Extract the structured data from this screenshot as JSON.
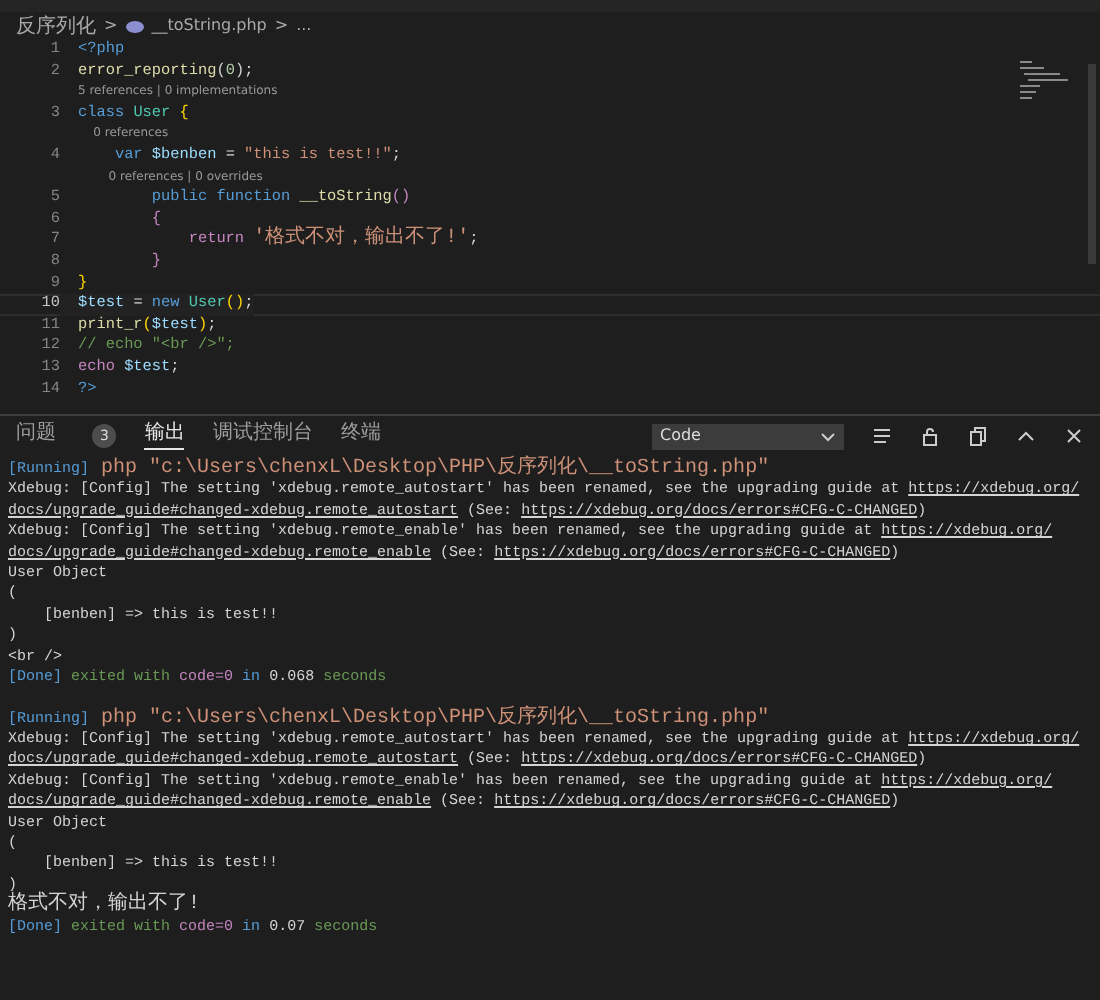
{
  "breadcrumb": {
    "items": [
      "反序列化",
      "__toString.php",
      "..."
    ],
    "separator": ">"
  },
  "editor": {
    "lines": [
      {
        "kind": "code",
        "number": "1",
        "current": false,
        "tokens": [
          {
            "text": "<?php",
            "kind": "kw"
          }
        ]
      },
      {
        "kind": "code",
        "number": "2",
        "current": false,
        "tokens": [
          {
            "text": "error_reporting",
            "kind": "fn"
          },
          {
            "text": "(",
            "kind": "plain"
          },
          {
            "text": "0",
            "kind": "num"
          },
          {
            "text": ");",
            "kind": "plain"
          }
        ]
      },
      {
        "kind": "lens",
        "text": "5 references | 0 implementations"
      },
      {
        "kind": "code",
        "number": "3",
        "current": false,
        "tokens": [
          {
            "text": "class ",
            "kind": "kw"
          },
          {
            "text": "User",
            "kind": "cls"
          },
          {
            "text": " {",
            "kind": "br"
          }
        ]
      },
      {
        "kind": "lens",
        "text": "    0 references"
      },
      {
        "kind": "code",
        "number": "4",
        "current": false,
        "tokens": [
          {
            "text": "    var",
            "kind": "kw"
          },
          {
            "text": " $benben",
            "kind": "var"
          },
          {
            "text": " = ",
            "kind": "plain"
          },
          {
            "text": "\"this is test!!\"",
            "kind": "str"
          },
          {
            "text": ";",
            "kind": "plain"
          }
        ]
      },
      {
        "kind": "lens",
        "text": "        0 references | 0 overrides"
      },
      {
        "kind": "code",
        "number": "5",
        "current": false,
        "tokens": [
          {
            "text": "        public function",
            "kind": "kw"
          },
          {
            "text": " __toString",
            "kind": "fn"
          },
          {
            "text": "()",
            "kind": "ctl"
          }
        ]
      },
      {
        "kind": "code",
        "number": "6",
        "current": false,
        "tokens": [
          {
            "text": "        {",
            "kind": "ctl"
          }
        ]
      },
      {
        "kind": "code",
        "number": "7",
        "current": false,
        "tokens": [
          {
            "text": "            return ",
            "kind": "ctl"
          },
          {
            "text": "'格式不对，输出不了!'",
            "kind": "str"
          },
          {
            "text": ";",
            "kind": "plain"
          }
        ]
      },
      {
        "kind": "code",
        "number": "8",
        "current": false,
        "tokens": [
          {
            "text": "        }",
            "kind": "ctl"
          }
        ]
      },
      {
        "kind": "code",
        "number": "9",
        "current": false,
        "tokens": [
          {
            "text": "}",
            "kind": "br"
          }
        ]
      },
      {
        "kind": "code",
        "number": "10",
        "current": true,
        "tokens": [
          {
            "text": "$test",
            "kind": "var"
          },
          {
            "text": " = ",
            "kind": "plain"
          },
          {
            "text": "new ",
            "kind": "kw"
          },
          {
            "text": "User",
            "kind": "cls"
          },
          {
            "text": "()",
            "kind": "br"
          },
          {
            "text": ";",
            "kind": "plain"
          }
        ]
      },
      {
        "kind": "code",
        "number": "11",
        "current": false,
        "tokens": [
          {
            "text": "print_r",
            "kind": "fn"
          },
          {
            "text": "(",
            "kind": "br"
          },
          {
            "text": "$test",
            "kind": "var"
          },
          {
            "text": ")",
            "kind": "br"
          },
          {
            "text": ";",
            "kind": "plain"
          }
        ]
      },
      {
        "kind": "code",
        "number": "12",
        "current": false,
        "tokens": [
          {
            "text": "// echo \"<br />\";",
            "kind": "cmt"
          }
        ]
      },
      {
        "kind": "code",
        "number": "13",
        "current": false,
        "tokens": [
          {
            "text": "echo",
            "kind": "ctl"
          },
          {
            "text": " $test",
            "kind": "var"
          },
          {
            "text": ";",
            "kind": "plain"
          }
        ]
      },
      {
        "kind": "code",
        "number": "14",
        "current": false,
        "tokens": [
          {
            "text": "?>",
            "kind": "kw"
          }
        ]
      }
    ]
  },
  "panel": {
    "tabs": [
      {
        "label": "问题",
        "badge": "3",
        "selected": false
      },
      {
        "label": "输出",
        "selected": true
      },
      {
        "label": "调试控制台",
        "selected": false
      },
      {
        "label": "终端",
        "selected": false
      }
    ],
    "channel": "Code",
    "output": [
      {
        "kind": "text",
        "tokens": [
          {
            "text": "[Running]",
            "kind": "tag"
          },
          {
            "text": " php \"c:\\Users\\chenxL\\Desktop\\PHP\\反序列化\\__toString.php\"",
            "kind": "str"
          }
        ]
      },
      {
        "kind": "text",
        "tokens": [
          {
            "text": "Xdebug: [Config] The setting 'xdebug.remote_autostart' has been renamed, see the upgrading guide at ",
            "kind": "plain"
          },
          {
            "text": "https://xdebug.org/",
            "kind": "link"
          }
        ]
      },
      {
        "kind": "text",
        "tokens": [
          {
            "text": "docs/upgrade_guide#changed-xdebug.remote_autostart",
            "kind": "link"
          },
          {
            "text": " (See: ",
            "kind": "plain"
          },
          {
            "text": "https://xdebug.org/docs/errors#CFG-C-CHANGED",
            "kind": "link"
          },
          {
            "text": ")",
            "kind": "plain"
          }
        ]
      },
      {
        "kind": "text",
        "tokens": [
          {
            "text": "Xdebug: [Config] The setting 'xdebug.remote_enable' has been renamed, see the upgrading guide at ",
            "kind": "plain"
          },
          {
            "text": "https://xdebug.org/",
            "kind": "link"
          }
        ]
      },
      {
        "kind": "text",
        "tokens": [
          {
            "text": "docs/upgrade_guide#changed-xdebug.remote_enable",
            "kind": "link"
          },
          {
            "text": " (See: ",
            "kind": "plain"
          },
          {
            "text": "https://xdebug.org/docs/errors#CFG-C-CHANGED",
            "kind": "link"
          },
          {
            "text": ")",
            "kind": "plain"
          }
        ]
      },
      {
        "kind": "text",
        "tokens": [
          {
            "text": "User Object",
            "kind": "plain"
          }
        ]
      },
      {
        "kind": "text",
        "tokens": [
          {
            "text": "(",
            "kind": "plain"
          }
        ]
      },
      {
        "kind": "text",
        "tokens": [
          {
            "text": "    [benben] => this is test!!",
            "kind": "plain"
          }
        ]
      },
      {
        "kind": "text",
        "tokens": [
          {
            "text": ")",
            "kind": "plain"
          }
        ]
      },
      {
        "kind": "text",
        "tokens": [
          {
            "text": "<br />",
            "kind": "plain"
          }
        ]
      },
      {
        "kind": "text",
        "tokens": [
          {
            "text": "[Done]",
            "kind": "tag"
          },
          {
            "text": " exited with ",
            "kind": "green"
          },
          {
            "text": "code=0",
            "kind": "purple"
          },
          {
            "text": " in ",
            "kind": "tag"
          },
          {
            "text": "0.068",
            "kind": "plain"
          },
          {
            "text": " seconds",
            "kind": "green"
          }
        ]
      },
      {
        "kind": "blank"
      },
      {
        "kind": "text",
        "tokens": [
          {
            "text": "[Running]",
            "kind": "tag"
          },
          {
            "text": " php \"c:\\Users\\chenxL\\Desktop\\PHP\\反序列化\\__toString.php\"",
            "kind": "str"
          }
        ]
      },
      {
        "kind": "text",
        "tokens": [
          {
            "text": "Xdebug: [Config] The setting 'xdebug.remote_autostart' has been renamed, see the upgrading guide at ",
            "kind": "plain"
          },
          {
            "text": "https://xdebug.org/",
            "kind": "link"
          }
        ]
      },
      {
        "kind": "text",
        "tokens": [
          {
            "text": "docs/upgrade_guide#changed-xdebug.remote_autostart",
            "kind": "link"
          },
          {
            "text": " (See: ",
            "kind": "plain"
          },
          {
            "text": "https://xdebug.org/docs/errors#CFG-C-CHANGED",
            "kind": "link"
          },
          {
            "text": ")",
            "kind": "plain"
          }
        ]
      },
      {
        "kind": "text",
        "tokens": [
          {
            "text": "Xdebug: [Config] The setting 'xdebug.remote_enable' has been renamed, see the upgrading guide at ",
            "kind": "plain"
          },
          {
            "text": "https://xdebug.org/",
            "kind": "link"
          }
        ]
      },
      {
        "kind": "text",
        "tokens": [
          {
            "text": "docs/upgrade_guide#changed-xdebug.remote_enable",
            "kind": "link"
          },
          {
            "text": " (See: ",
            "kind": "plain"
          },
          {
            "text": "https://xdebug.org/docs/errors#CFG-C-CHANGED",
            "kind": "link"
          },
          {
            "text": ")",
            "kind": "plain"
          }
        ]
      },
      {
        "kind": "text",
        "tokens": [
          {
            "text": "User Object",
            "kind": "plain"
          }
        ]
      },
      {
        "kind": "text",
        "tokens": [
          {
            "text": "(",
            "kind": "plain"
          }
        ]
      },
      {
        "kind": "text",
        "tokens": [
          {
            "text": "    [benben] => this is test!!",
            "kind": "plain"
          }
        ]
      },
      {
        "kind": "text",
        "tokens": [
          {
            "text": ")",
            "kind": "plain"
          }
        ]
      },
      {
        "kind": "text",
        "tokens": [
          {
            "text": "格式不对，输出不了!",
            "kind": "plain"
          }
        ]
      },
      {
        "kind": "text",
        "tokens": [
          {
            "text": "[Done]",
            "kind": "tag"
          },
          {
            "text": " exited with ",
            "kind": "green"
          },
          {
            "text": "code=0",
            "kind": "purple"
          },
          {
            "text": " in ",
            "kind": "tag"
          },
          {
            "text": "0.07",
            "kind": "plain"
          },
          {
            "text": " seconds",
            "kind": "green"
          }
        ]
      }
    ]
  }
}
